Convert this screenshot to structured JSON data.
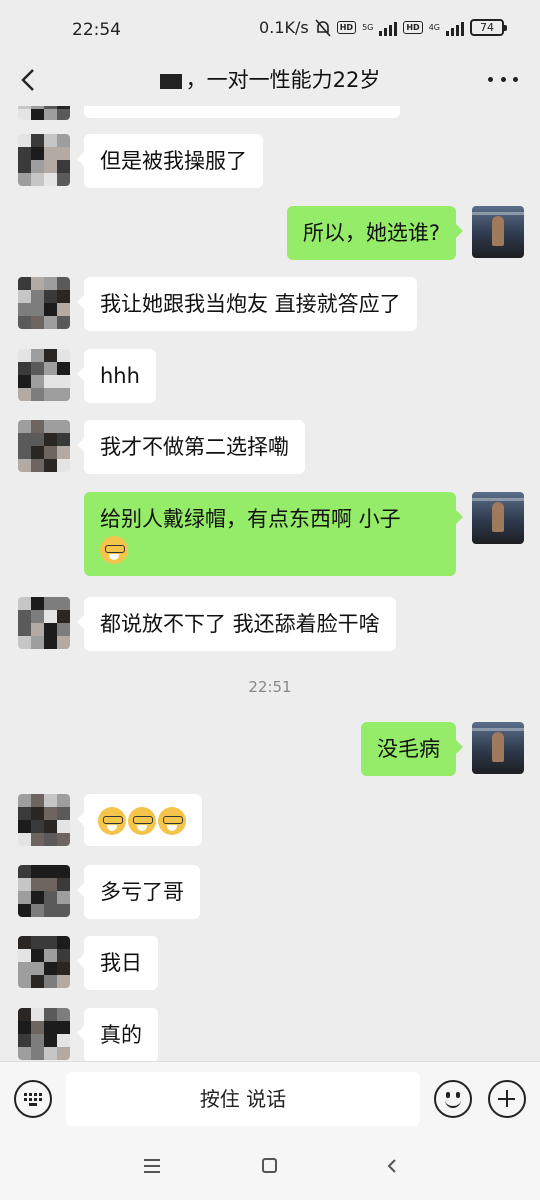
{
  "status_bar": {
    "time": "22:54",
    "speed": "0.1K/s",
    "net1": "5G",
    "net2": "4G",
    "hd": "HD",
    "battery": "74"
  },
  "nav": {
    "title": "，一对一性能力22岁"
  },
  "messages": [
    {
      "side": "left",
      "text": "但是被我操服了"
    },
    {
      "side": "right",
      "text": "所以，她选谁?"
    },
    {
      "side": "left",
      "text": "我让她跟我当炮友 直接就答应了"
    },
    {
      "side": "left",
      "text": "hhh"
    },
    {
      "side": "left",
      "text": "我才不做第二选择嘞"
    },
    {
      "side": "right",
      "text": "给别人戴绿帽，有点东西啊  小子"
    },
    {
      "side": "left",
      "text": "都说放不下了 我还舔着脸干啥"
    },
    {
      "timestamp": "22:51"
    },
    {
      "side": "right",
      "text": "没毛病"
    },
    {
      "side": "left",
      "emoji_count": 3
    },
    {
      "side": "left",
      "text": "多亏了哥"
    },
    {
      "side": "left",
      "text": "我日"
    },
    {
      "side": "left",
      "text": "真的"
    }
  ],
  "input_bar": {
    "hold_to_talk": "按住 说话"
  }
}
